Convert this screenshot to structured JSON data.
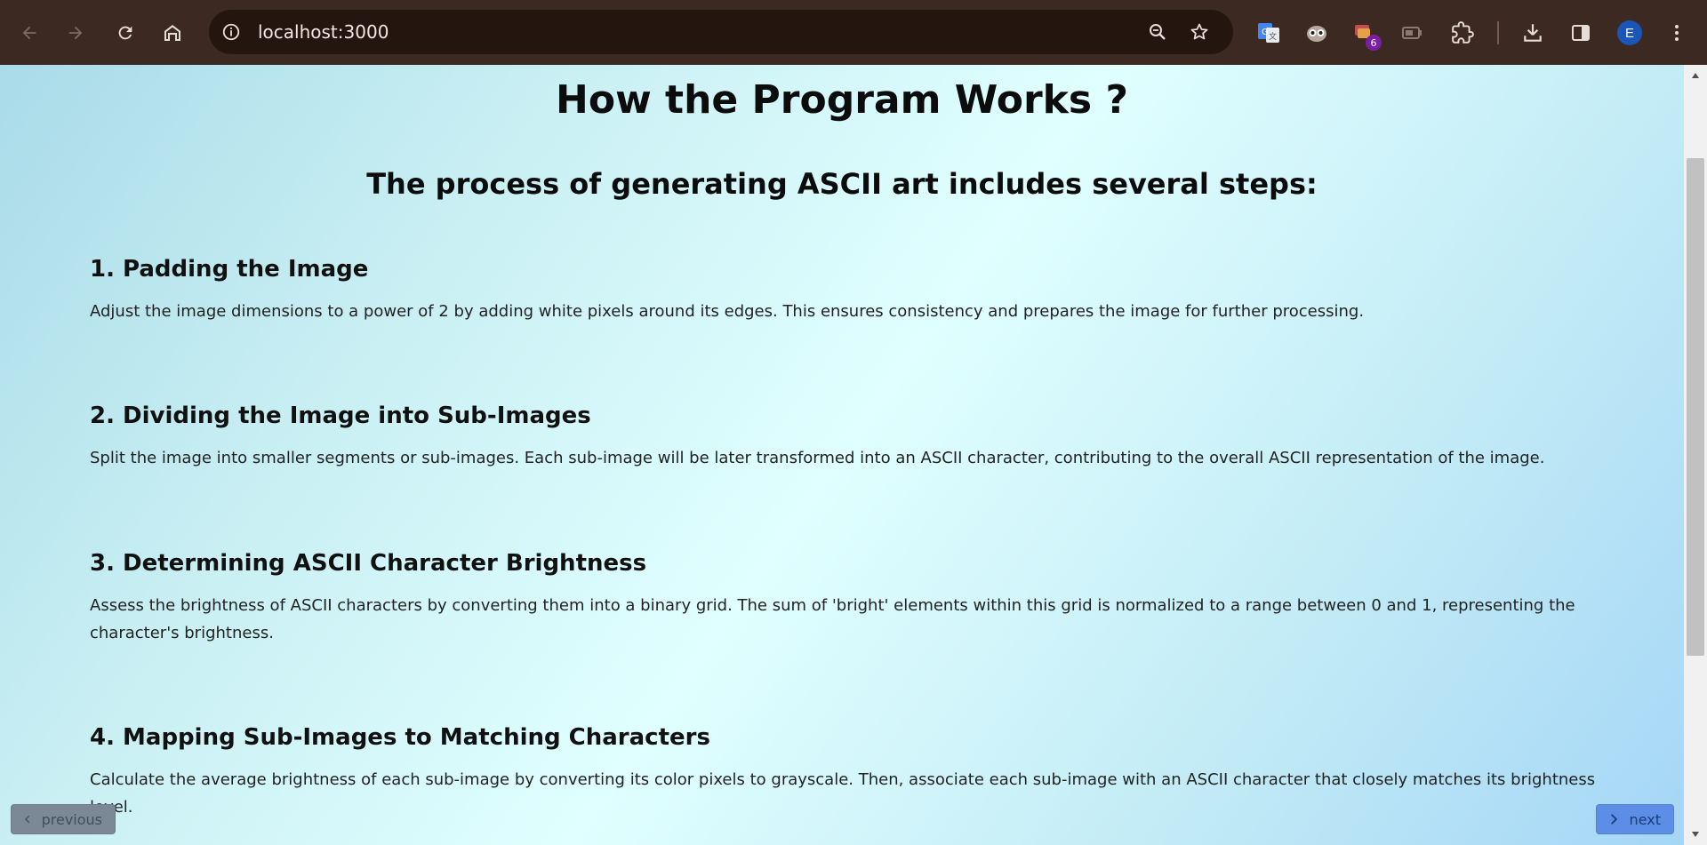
{
  "browser": {
    "url": "localhost:3000",
    "profile_initial": "E",
    "extension_badge": "6"
  },
  "page": {
    "title": "How the Program Works ?",
    "subtitle": "The process of generating ASCII art includes several steps:",
    "steps": [
      {
        "heading": "1. Padding the Image",
        "text": "Adjust the image dimensions to a power of 2 by adding white pixels around its edges. This ensures consistency and prepares the image for further processing."
      },
      {
        "heading": "2. Dividing the Image into Sub-Images",
        "text": "Split the image into smaller segments or sub-images. Each sub-image will be later transformed into an ASCII character, contributing to the overall ASCII representation of the image."
      },
      {
        "heading": "3. Determining ASCII Character Brightness",
        "text": "Assess the brightness of ASCII characters by converting them into a binary grid. The sum of 'bright' elements within this grid is normalized to a range between 0 and 1, representing the character's brightness."
      },
      {
        "heading": "4. Mapping Sub-Images to Matching Characters",
        "text": "Calculate the average brightness of each sub-image by converting its color pixels to grayscale. Then, associate each sub-image with an ASCII character that closely matches its brightness level."
      }
    ]
  },
  "pager": {
    "previous_label": "previous",
    "next_label": "next"
  }
}
